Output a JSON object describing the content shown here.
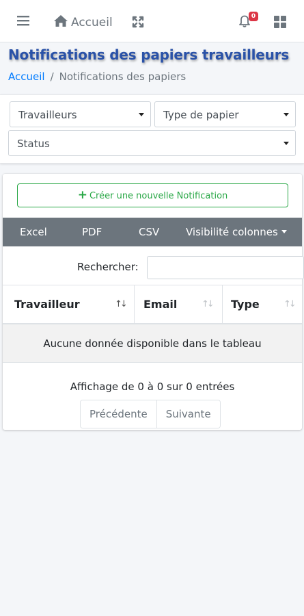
{
  "navbar": {
    "menu_icon": "hamburger-icon",
    "home_label": "Accueil",
    "home_icon": "home-icon",
    "fullscreen_icon": "expand-icon",
    "bell_icon": "bell-icon",
    "notif_count": "0",
    "apps_icon": "grid-icon"
  },
  "header": {
    "title": "Notifications des papiers travailleurs",
    "breadcrumb": {
      "home": "Accueil",
      "separator": "/",
      "current": "Notifications des papiers"
    }
  },
  "filters": {
    "travailleurs": "Travailleurs",
    "type_papier": "Type de papier",
    "status": "Status"
  },
  "actions": {
    "create_label": "Créer une nouvelle Notification"
  },
  "toolbar": {
    "excel": "Excel",
    "pdf": "PDF",
    "csv": "CSV",
    "columns": "Visibilité colonnes"
  },
  "search": {
    "label": "Rechercher:",
    "value": ""
  },
  "table": {
    "columns": [
      "Travailleur",
      "Email",
      "Type"
    ],
    "empty_message": "Aucune donnée disponible dans le tableau"
  },
  "footer": {
    "info": "Affichage de 0 à 0 sur 0 entrées",
    "prev": "Précédente",
    "next": "Suivante"
  },
  "colors": {
    "title": "#2a52a8",
    "link": "#007bff",
    "success": "#28a745",
    "toolbar": "#6c757d",
    "badge": "#dc3545"
  }
}
